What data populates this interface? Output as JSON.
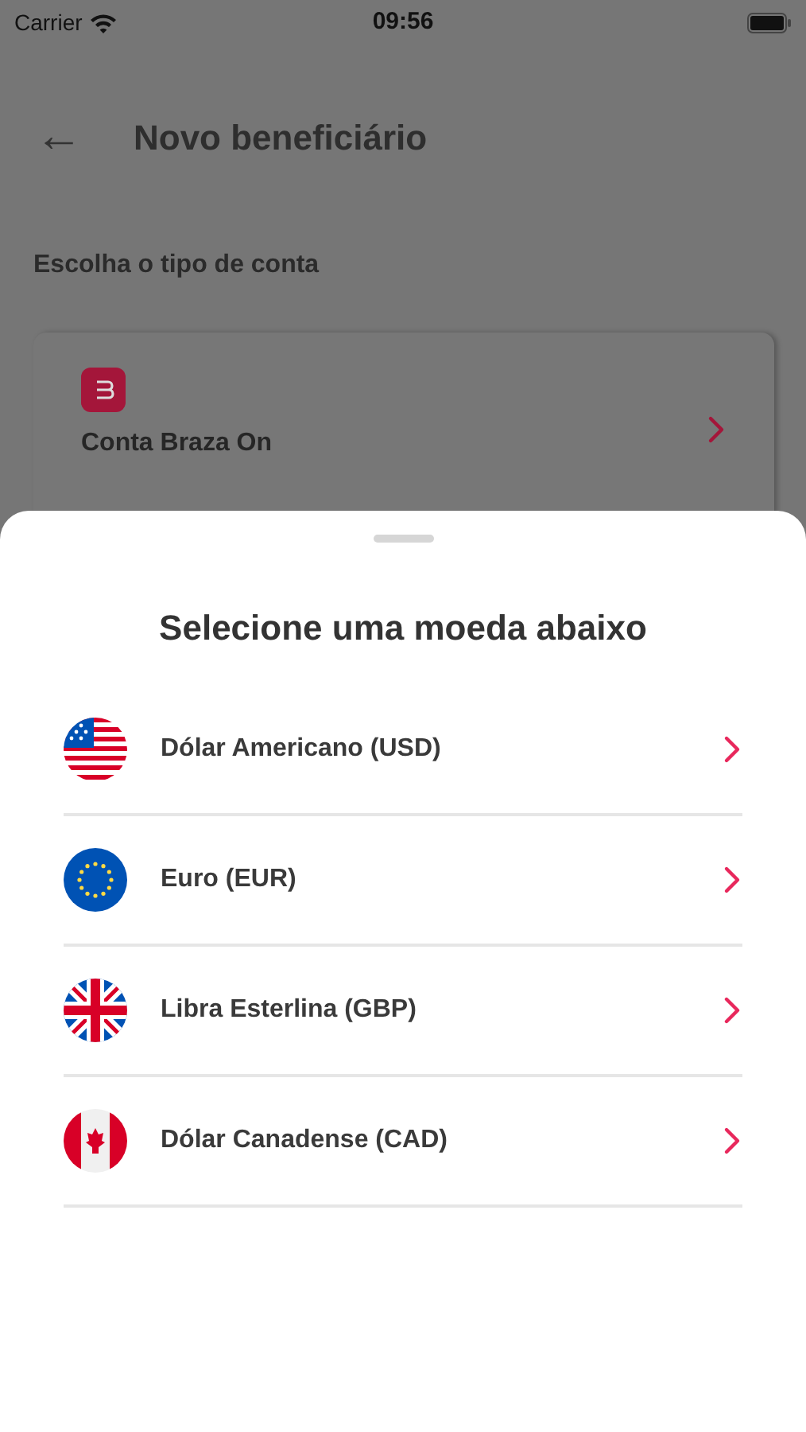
{
  "status_bar": {
    "carrier": "Carrier",
    "time": "09:56"
  },
  "header": {
    "back": "←",
    "title": "Novo beneficiário"
  },
  "section_label": "Escolha o tipo de conta",
  "account_card": {
    "title": "Conta Braza On"
  },
  "sheet": {
    "title": "Selecione uma moeda abaixo",
    "currencies": [
      {
        "kind": "us",
        "label": "Dólar Americano (USD)"
      },
      {
        "kind": "eu",
        "label": "Euro (EUR)"
      },
      {
        "kind": "gb",
        "label": "Libra Esterlina (GBP)"
      },
      {
        "kind": "ca",
        "label": "Dólar Canadense (CAD)"
      }
    ]
  }
}
